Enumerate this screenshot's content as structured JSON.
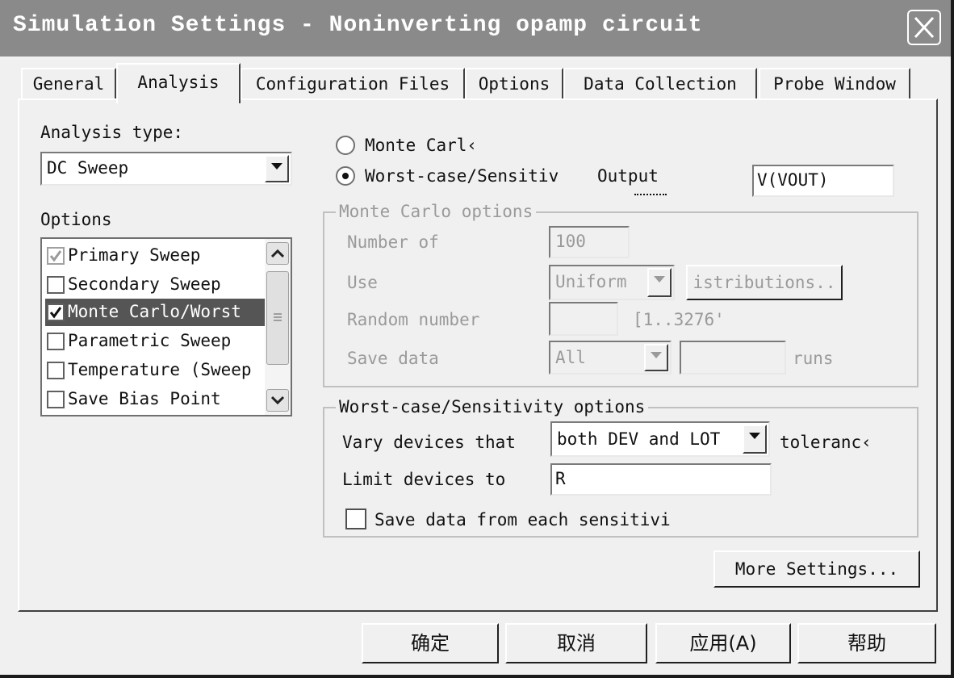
{
  "window": {
    "title": "Simulation Settings - Noninverting opamp circuit"
  },
  "tabs": [
    {
      "label": "General"
    },
    {
      "label": "Analysis"
    },
    {
      "label": "Configuration Files"
    },
    {
      "label": "Options"
    },
    {
      "label": "Data Collection"
    },
    {
      "label": "Probe Window"
    }
  ],
  "active_tab": "Analysis",
  "analysis_type": {
    "label": "Analysis type:",
    "value": "DC Sweep"
  },
  "options": {
    "label": "Options",
    "items": [
      {
        "label": "Primary Sweep",
        "checked": true,
        "disabled": true
      },
      {
        "label": "Secondary Sweep",
        "checked": false
      },
      {
        "label": "Monte Carlo/Worst",
        "checked": true,
        "selected": true
      },
      {
        "label": "Parametric Sweep",
        "checked": false
      },
      {
        "label": "Temperature (Sweep",
        "checked": false
      },
      {
        "label": "Save Bias Point",
        "checked": false
      }
    ]
  },
  "mode": {
    "monte_carlo_label": "Monte Carl‹",
    "worst_case_label": "Worst-case/Sensitiv",
    "selected": "worst_case",
    "output_label": "Output",
    "output_value": "V(VOUT)"
  },
  "monte_carlo_options": {
    "title": "Monte Carlo options",
    "number_label": "Number of",
    "number_value": "100",
    "use_label": "Use",
    "use_value": "Uniform",
    "distributions_button": "istributions..",
    "random_label": "Random number",
    "random_value": "",
    "random_range": "[1..3276'",
    "save_label": "Save data",
    "save_value": "All",
    "runs_value": "",
    "runs_label": "runs"
  },
  "worst_case_options": {
    "title": "Worst-case/Sensitivity options",
    "vary_label": "Vary devices that",
    "vary_value": "both DEV and LOT",
    "tolerance_label": "toleranc‹",
    "limit_label": "Limit devices to",
    "limit_value": "R",
    "save_each_label": "Save data from each sensitivi",
    "save_each_checked": false
  },
  "buttons": {
    "more_settings": "More Settings...",
    "ok": "确定",
    "cancel": "取消",
    "apply": "应用(A)",
    "help": "帮助"
  }
}
